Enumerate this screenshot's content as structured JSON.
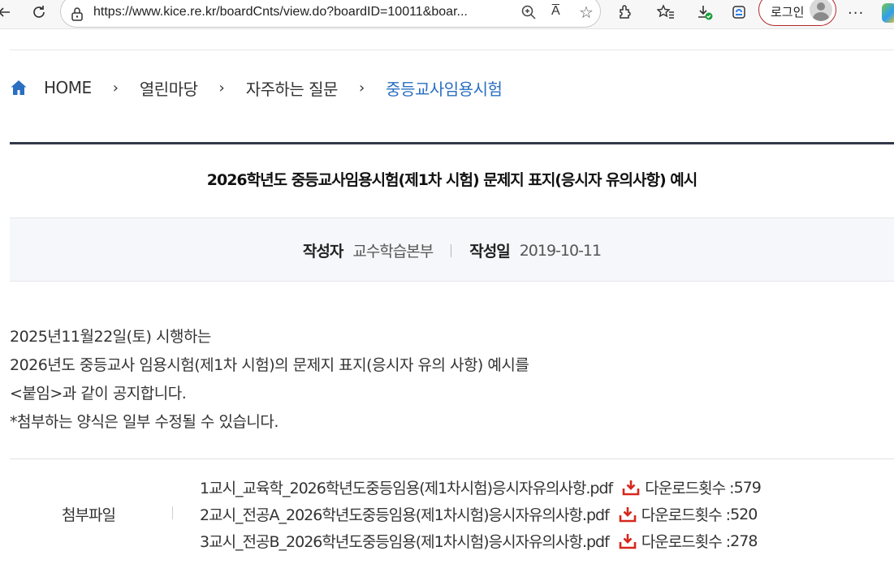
{
  "browser": {
    "url": "https://www.kice.re.kr/boardCnts/view.do?boardID=10011&boar...",
    "read_aloud_label": "A̅",
    "login_label": "로그인"
  },
  "breadcrumb": {
    "home": "HOME",
    "items": [
      "열린마당",
      "자주하는 질문"
    ],
    "current": "중등교사임용시험"
  },
  "post": {
    "title": "2026학년도 중등교사임용시험(제1차 시험) 문제지 표지(응시자 유의사항) 예시",
    "author_label": "작성자",
    "author": "교수학습본부",
    "date_label": "작성일",
    "date": "2019-10-11",
    "body": [
      "2025년11월22일(토) 시행하는",
      "2026년도 중등교사 임용시험(제1차 시험)의 문제지 표지(응시자 유의 사항) 예시를",
      "<붙임>과 같이 공지합니다.",
      "*첨부하는 양식은 일부 수정될 수 있습니다."
    ]
  },
  "attachments": {
    "label": "첨부파일",
    "count_label": "다운로드횟수 : ",
    "files": [
      {
        "name": "1교시_교육학_2026학년도중등임용(제1차시험)응시자유의사항.pdf",
        "downloads": "579"
      },
      {
        "name": "2교시_전공A_2026학년도중등임용(제1차시험)응시자유의사항.pdf",
        "downloads": "520"
      },
      {
        "name": "3교시_전공B_2026학년도중등임용(제1차시험)응시자유의사항.pdf",
        "downloads": "278"
      }
    ]
  },
  "colors": {
    "accent": "#2a6fc0",
    "title_rule": "#33394a",
    "download_icon": "#d8261c",
    "login_border": "#b22a2a"
  },
  "icons": [
    "back-icon",
    "refresh-icon",
    "lock-icon",
    "zoom-icon",
    "read-aloud-icon",
    "favorite-star-icon",
    "extensions-icon",
    "favorites-icon",
    "downloads-icon",
    "collections-icon",
    "more-icon",
    "home-icon",
    "chevron-right-icon",
    "download-icon"
  ]
}
